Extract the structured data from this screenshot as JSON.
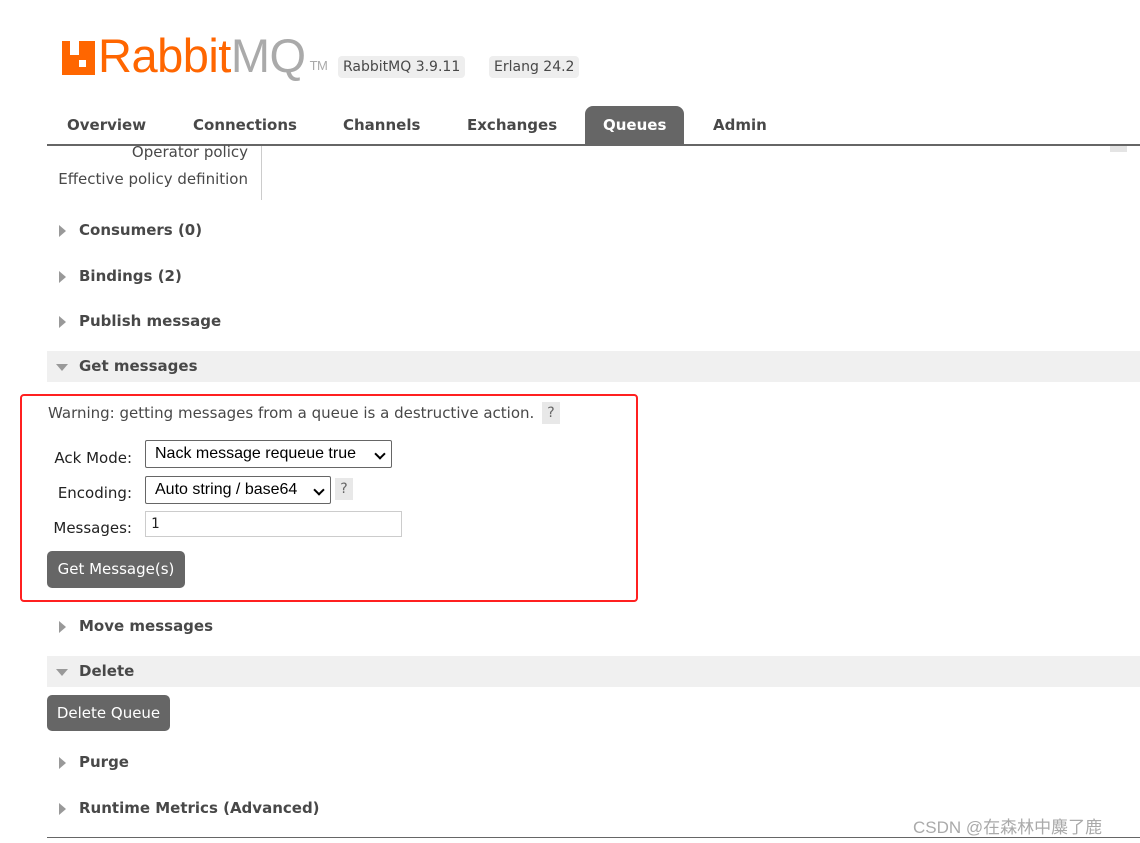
{
  "header": {
    "logo_text_primary": "Rabbit",
    "logo_text_secondary": "MQ",
    "logo_tm": "TM",
    "version_badge": "RabbitMQ 3.9.11",
    "erlang_badge": "Erlang 24.2"
  },
  "nav": {
    "tabs": [
      {
        "label": "Overview"
      },
      {
        "label": "Connections"
      },
      {
        "label": "Channels"
      },
      {
        "label": "Exchanges"
      },
      {
        "label": "Queues",
        "active": true
      },
      {
        "label": "Admin"
      }
    ]
  },
  "details": {
    "operator_policy": "Operator policy",
    "effective_policy": "Effective policy definition"
  },
  "sections": {
    "consumers": "Consumers (0)",
    "bindings": "Bindings (2)",
    "publish": "Publish message",
    "get": "Get messages",
    "move": "Move messages",
    "delete": "Delete",
    "purge": "Purge",
    "runtime": "Runtime Metrics (Advanced)"
  },
  "get_messages": {
    "warning": "Warning: getting messages from a queue is a destructive action.",
    "help": "?",
    "ack_mode_label": "Ack Mode:",
    "ack_mode_value": "Nack message requeue true",
    "encoding_label": "Encoding:",
    "encoding_value": "Auto string / base64",
    "messages_label": "Messages:",
    "messages_value": "1",
    "button": "Get Message(s)"
  },
  "delete": {
    "button": "Delete Queue"
  },
  "highlight_color": "#ff2020",
  "watermark": "CSDN @在森林中麋了鹿"
}
